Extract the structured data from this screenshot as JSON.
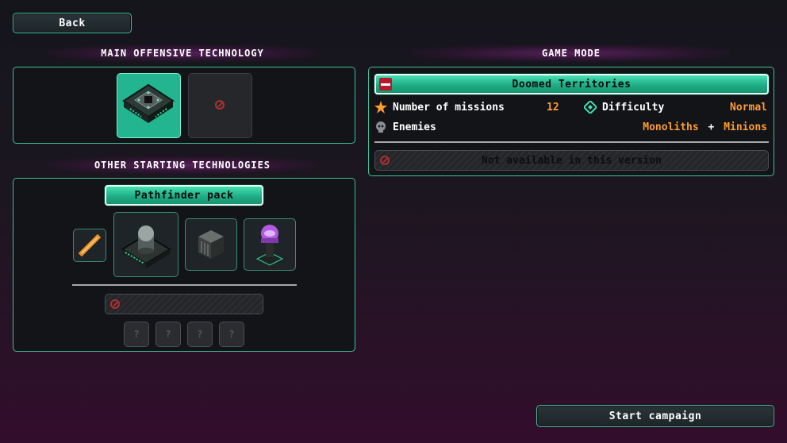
{
  "back_label": "Back",
  "main_offensive": {
    "title": "MAIN OFFENSIVE TECHNOLOGY"
  },
  "other_starting": {
    "title": "OTHER STARTING TECHNOLOGIES",
    "pack_label": "Pathfinder pack",
    "locked_slot_glyph": "?"
  },
  "game_mode": {
    "title": "GAME MODE",
    "mode_name": "Doomed Territories",
    "missions_label": "Number of missions",
    "missions_value": "12",
    "difficulty_label": "Difficulty",
    "difficulty_value": "Normal",
    "enemies_label": "Enemies",
    "enemies_value_1": "Monoliths",
    "enemies_plus": "+",
    "enemies_value_2": "Minions",
    "unavailable_text": "Not available in this version"
  },
  "start_label": "Start campaign",
  "colors": {
    "accent": "#3fbf9a",
    "highlight": "#ff9c33",
    "banner": "#22b58f"
  }
}
